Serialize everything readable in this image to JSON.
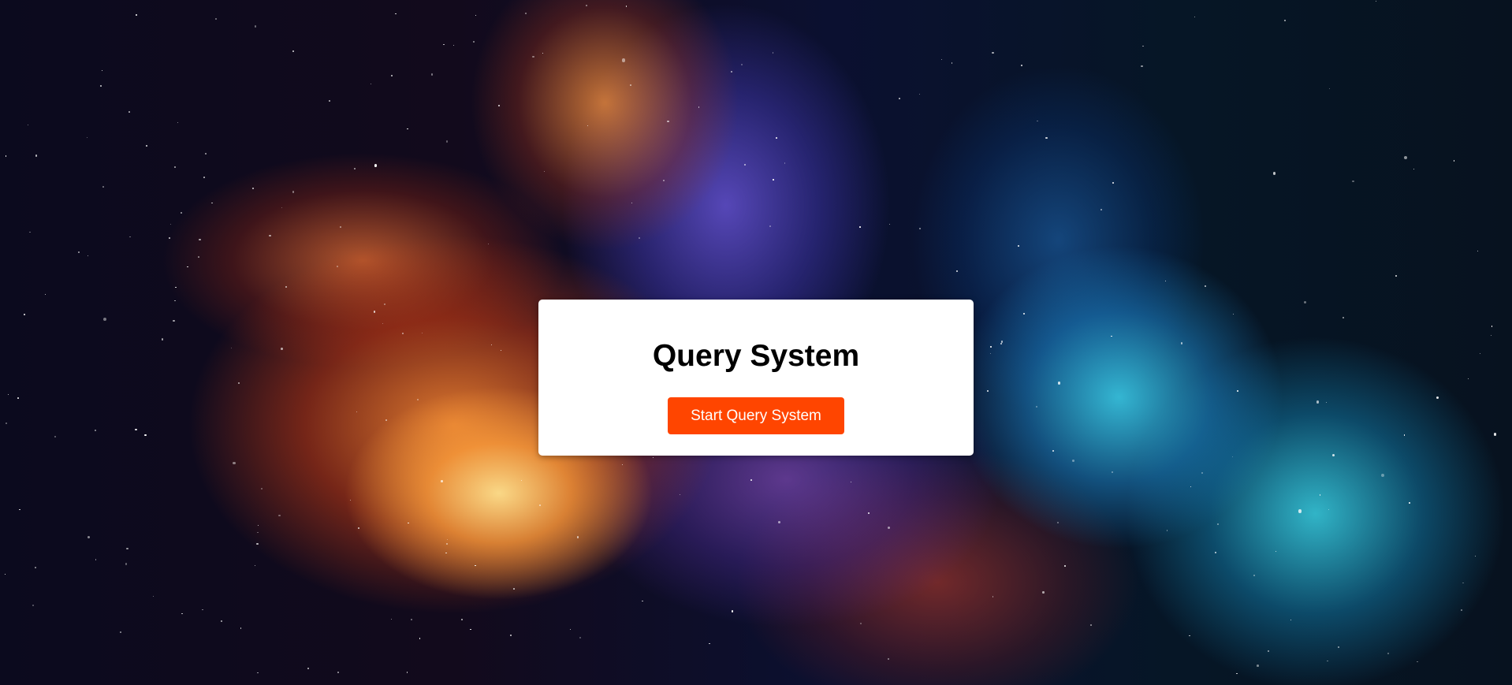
{
  "page": {
    "title": "Query System",
    "start_button_label": "Start Query System"
  },
  "colors": {
    "button_background": "#ff4500",
    "card_background": "#ffffff",
    "title_text": "#000000"
  },
  "background": {
    "description_icon": "space-nebula-background"
  }
}
